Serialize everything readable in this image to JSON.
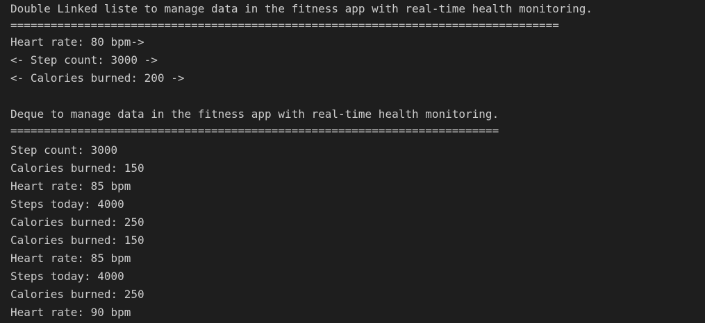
{
  "terminal": {
    "linked_list_section": {
      "title": "Double Linked liste to manage data in the fitness app with real-time health monitoring.",
      "separator": "==================================================================================",
      "entries": [
        "Heart rate: 80 bpm->",
        "<- Step count: 3000 ->",
        "<- Calories burned: 200 ->"
      ]
    },
    "deque_section": {
      "title": "Deque to manage data in the fitness app with real-time health monitoring.",
      "separator": "=========================================================================",
      "entries": [
        "Step count: 3000",
        "Calories burned: 150",
        "Heart rate: 85 bpm",
        "Steps today: 4000",
        "Calories burned: 250",
        "Calories burned: 150",
        "Heart rate: 85 bpm",
        "Steps today: 4000",
        "Calories burned: 250",
        "Heart rate: 90 bpm"
      ]
    }
  }
}
